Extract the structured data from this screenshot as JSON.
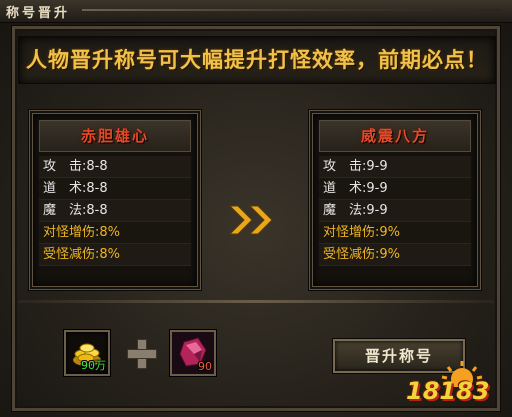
{
  "window": {
    "title": "称号晋升"
  },
  "banner": {
    "text": "人物晋升称号可大幅提升打怪效率，前期必点！"
  },
  "current_title": {
    "name": "赤胆雄心",
    "stats": [
      {
        "label": "攻　击:",
        "value": "8-8",
        "tone": "white"
      },
      {
        "label": "道　术:",
        "value": "8-8",
        "tone": "white"
      },
      {
        "label": "魔　法:",
        "value": "8-8",
        "tone": "white"
      },
      {
        "label": "对怪增伤:",
        "value": "8%",
        "tone": "gold"
      },
      {
        "label": "受怪减伤:",
        "value": "8%",
        "tone": "gold"
      }
    ]
  },
  "next_title": {
    "name": "威震八方",
    "stats": [
      {
        "label": "攻　击:",
        "value": "9-9",
        "tone": "white"
      },
      {
        "label": "道　术:",
        "value": "9-9",
        "tone": "white"
      },
      {
        "label": "魔　法:",
        "value": "9-9",
        "tone": "white"
      },
      {
        "label": "对怪增伤:",
        "value": "9%",
        "tone": "gold"
      },
      {
        "label": "受怪减伤:",
        "value": "9%",
        "tone": "gold"
      }
    ]
  },
  "cost": {
    "gold": {
      "icon": "gold-coins-icon",
      "amount": "90万",
      "color": "#42e842"
    },
    "gem": {
      "icon": "red-gem-icon",
      "amount": "90",
      "color": "#f25a3a"
    }
  },
  "actions": {
    "promote_label": "晋升称号"
  },
  "watermark": {
    "text": "18183",
    "logo": "sun-logo"
  },
  "colors": {
    "banner": "#f0c24a",
    "title_name": "#e44a2a",
    "stat_highlight": "#f1b423",
    "arrow": "#e8a81c"
  }
}
